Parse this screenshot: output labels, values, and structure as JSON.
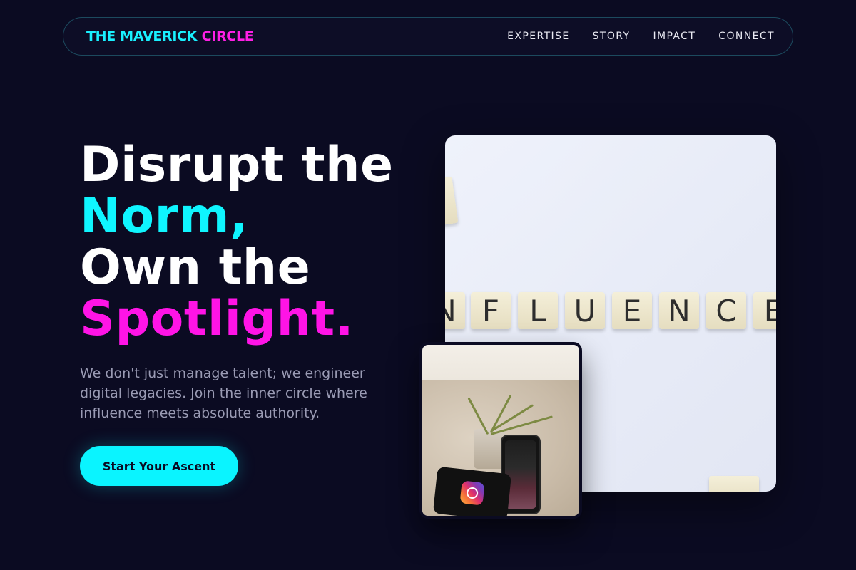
{
  "brand": {
    "part1": "THE MAVERICK",
    "part2": "CIRCLE"
  },
  "nav": {
    "links": [
      "EXPERTISE",
      "STORY",
      "IMPACT",
      "CONNECT"
    ]
  },
  "hero": {
    "line1": "Disrupt the",
    "line2": "Norm,",
    "line3": "Own the",
    "line4": "Spotlight.",
    "description": "We don't just manage talent; we engineer digital legacies. Join the inner circle where influence meets absolute authority.",
    "cta_label": "Start Your Ascent"
  },
  "images": {
    "main": {
      "tiles": [
        "N",
        "F",
        "L",
        "U",
        "E",
        "N",
        "C",
        "E"
      ]
    },
    "secondary": {
      "icon": "instagram-icon"
    }
  },
  "colors": {
    "background": "#0b0b22",
    "cyan": "#0af4ff",
    "magenta": "#ff14e6"
  }
}
